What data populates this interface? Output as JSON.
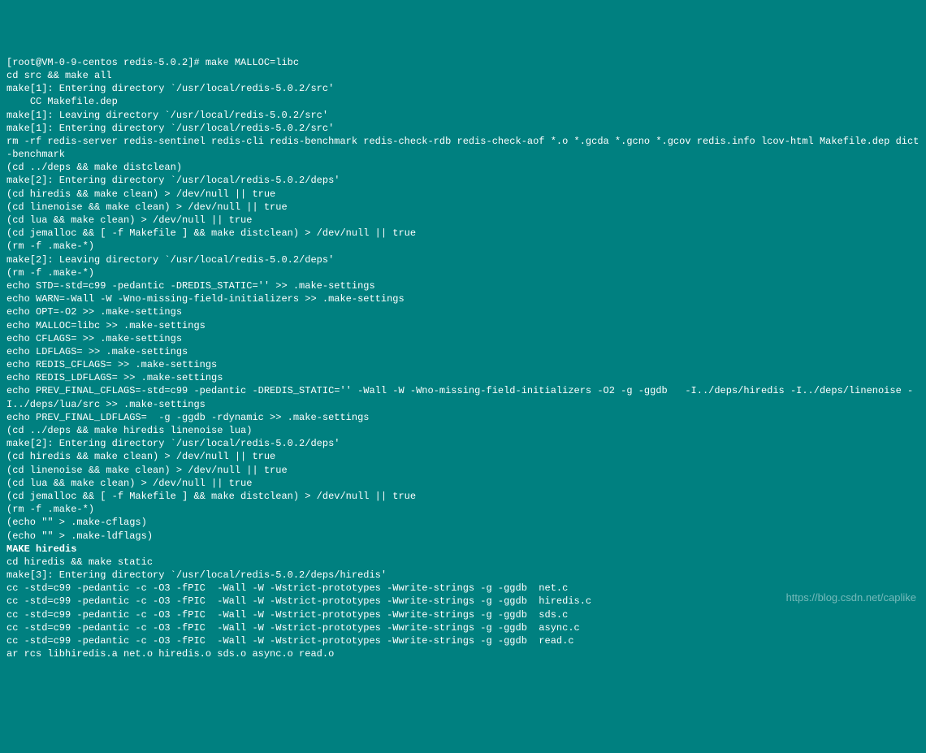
{
  "terminal": {
    "lines": [
      {
        "text": "[root@VM-0-9-centos redis-5.0.2]# make MALLOC=libc",
        "bold": false
      },
      {
        "text": "cd src && make all",
        "bold": false
      },
      {
        "text": "make[1]: Entering directory `/usr/local/redis-5.0.2/src'",
        "bold": false
      },
      {
        "text": "    CC Makefile.dep",
        "bold": false
      },
      {
        "text": "make[1]: Leaving directory `/usr/local/redis-5.0.2/src'",
        "bold": false
      },
      {
        "text": "make[1]: Entering directory `/usr/local/redis-5.0.2/src'",
        "bold": false
      },
      {
        "text": "rm -rf redis-server redis-sentinel redis-cli redis-benchmark redis-check-rdb redis-check-aof *.o *.gcda *.gcno *.gcov redis.info lcov-html Makefile.dep dict-benchmark",
        "bold": false
      },
      {
        "text": "(cd ../deps && make distclean)",
        "bold": false
      },
      {
        "text": "make[2]: Entering directory `/usr/local/redis-5.0.2/deps'",
        "bold": false
      },
      {
        "text": "(cd hiredis && make clean) > /dev/null || true",
        "bold": false
      },
      {
        "text": "(cd linenoise && make clean) > /dev/null || true",
        "bold": false
      },
      {
        "text": "(cd lua && make clean) > /dev/null || true",
        "bold": false
      },
      {
        "text": "(cd jemalloc && [ -f Makefile ] && make distclean) > /dev/null || true",
        "bold": false
      },
      {
        "text": "(rm -f .make-*)",
        "bold": false
      },
      {
        "text": "make[2]: Leaving directory `/usr/local/redis-5.0.2/deps'",
        "bold": false
      },
      {
        "text": "(rm -f .make-*)",
        "bold": false
      },
      {
        "text": "echo STD=-std=c99 -pedantic -DREDIS_STATIC='' >> .make-settings",
        "bold": false
      },
      {
        "text": "echo WARN=-Wall -W -Wno-missing-field-initializers >> .make-settings",
        "bold": false
      },
      {
        "text": "echo OPT=-O2 >> .make-settings",
        "bold": false
      },
      {
        "text": "echo MALLOC=libc >> .make-settings",
        "bold": false
      },
      {
        "text": "echo CFLAGS= >> .make-settings",
        "bold": false
      },
      {
        "text": "echo LDFLAGS= >> .make-settings",
        "bold": false
      },
      {
        "text": "echo REDIS_CFLAGS= >> .make-settings",
        "bold": false
      },
      {
        "text": "echo REDIS_LDFLAGS= >> .make-settings",
        "bold": false
      },
      {
        "text": "echo PREV_FINAL_CFLAGS=-std=c99 -pedantic -DREDIS_STATIC='' -Wall -W -Wno-missing-field-initializers -O2 -g -ggdb   -I../deps/hiredis -I../deps/linenoise -I../deps/lua/src >> .make-settings",
        "bold": false
      },
      {
        "text": "echo PREV_FINAL_LDFLAGS=  -g -ggdb -rdynamic >> .make-settings",
        "bold": false
      },
      {
        "text": "(cd ../deps && make hiredis linenoise lua)",
        "bold": false
      },
      {
        "text": "make[2]: Entering directory `/usr/local/redis-5.0.2/deps'",
        "bold": false
      },
      {
        "text": "(cd hiredis && make clean) > /dev/null || true",
        "bold": false
      },
      {
        "text": "(cd linenoise && make clean) > /dev/null || true",
        "bold": false
      },
      {
        "text": "(cd lua && make clean) > /dev/null || true",
        "bold": false
      },
      {
        "text": "(cd jemalloc && [ -f Makefile ] && make distclean) > /dev/null || true",
        "bold": false
      },
      {
        "text": "(rm -f .make-*)",
        "bold": false
      },
      {
        "text": "(echo \"\" > .make-cflags)",
        "bold": false
      },
      {
        "text": "(echo \"\" > .make-ldflags)",
        "bold": false
      },
      {
        "text": "MAKE hiredis",
        "bold": true
      },
      {
        "text": "cd hiredis && make static",
        "bold": false
      },
      {
        "text": "make[3]: Entering directory `/usr/local/redis-5.0.2/deps/hiredis'",
        "bold": false
      },
      {
        "text": "cc -std=c99 -pedantic -c -O3 -fPIC  -Wall -W -Wstrict-prototypes -Wwrite-strings -g -ggdb  net.c",
        "bold": false
      },
      {
        "text": "cc -std=c99 -pedantic -c -O3 -fPIC  -Wall -W -Wstrict-prototypes -Wwrite-strings -g -ggdb  hiredis.c",
        "bold": false
      },
      {
        "text": "cc -std=c99 -pedantic -c -O3 -fPIC  -Wall -W -Wstrict-prototypes -Wwrite-strings -g -ggdb  sds.c",
        "bold": false
      },
      {
        "text": "cc -std=c99 -pedantic -c -O3 -fPIC  -Wall -W -Wstrict-prototypes -Wwrite-strings -g -ggdb  async.c",
        "bold": false
      },
      {
        "text": "cc -std=c99 -pedantic -c -O3 -fPIC  -Wall -W -Wstrict-prototypes -Wwrite-strings -g -ggdb  read.c",
        "bold": false
      },
      {
        "text": "ar rcs libhiredis.a net.o hiredis.o sds.o async.o read.o",
        "bold": false
      }
    ]
  },
  "watermark": {
    "text": "https://blog.csdn.net/caplike"
  }
}
